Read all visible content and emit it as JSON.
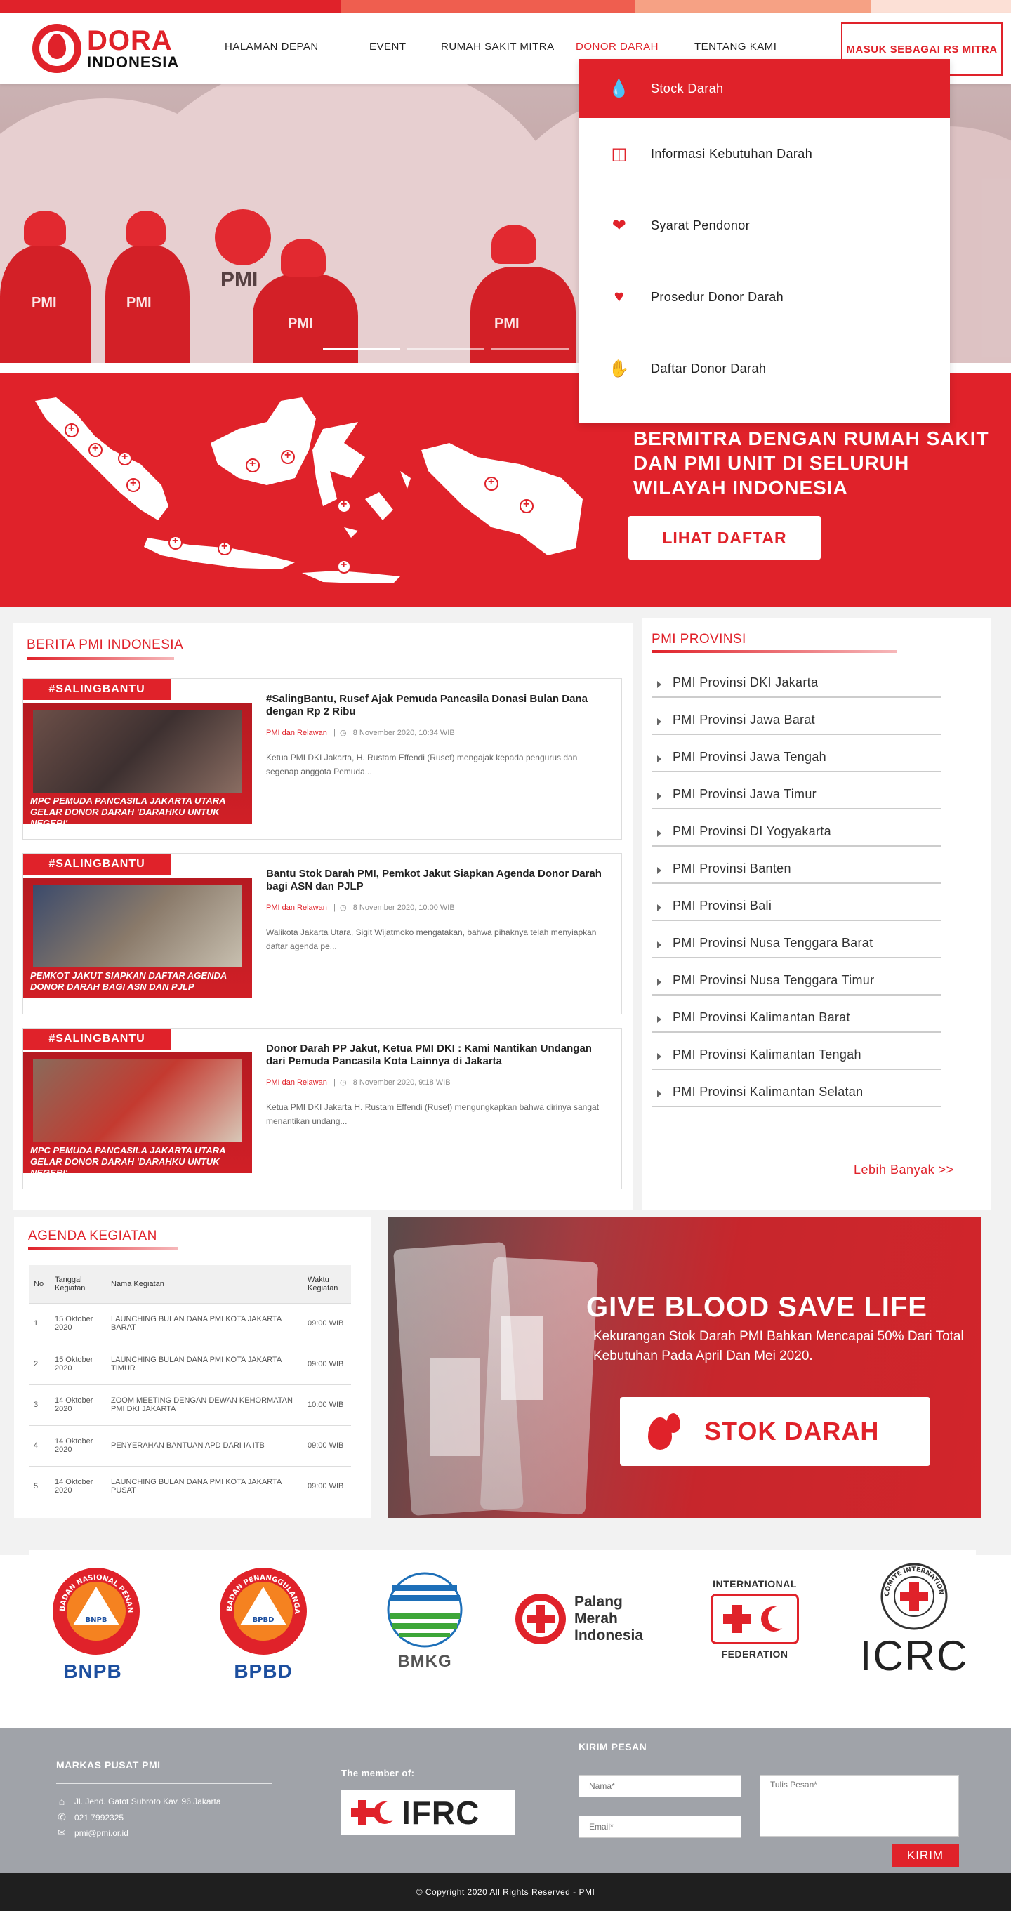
{
  "brand": {
    "name_line1": "DORA",
    "name_line2": "INDONESIA",
    "accent": "#e0222a"
  },
  "nav": {
    "items": [
      "HALAMAN DEPAN",
      "EVENT",
      "RUMAH SAKIT MITRA",
      "DONOR DARAH",
      "TENTANG KAMI"
    ],
    "active": "DONOR DARAH",
    "cta": "MASUK SEBAGAI RS MITRA"
  },
  "dropdown": {
    "items": [
      {
        "label": "Stock Darah",
        "icon": "blood-drop-icon"
      },
      {
        "label": "Informasi Kebutuhan Darah",
        "icon": "blood-bag-icon"
      },
      {
        "label": "Syarat Pendonor",
        "icon": "hand-heart-icon"
      },
      {
        "label": "Prosedur Donor Darah",
        "icon": "heart-plus-icon"
      },
      {
        "label": "Daftar Donor Darah",
        "icon": "raised-hand-icon"
      }
    ]
  },
  "hero": {
    "vest_text": "PMI"
  },
  "mitra": {
    "title": "BERMITRA DENGAN RUMAH SAKIT DAN PMI UNIT DI SELURUH WILAYAH INDONESIA",
    "button": "LIHAT DAFTAR"
  },
  "news": {
    "title": "BERITA PMI INDONESIA",
    "items": [
      {
        "tag": "#SALINGBANTU",
        "thumb_caption": "MPC PEMUDA PANCASILA JAKARTA UTARA GELAR DONOR DARAH 'DARAHKU UNTUK NEGERI'",
        "title": "#SalingBantu, Rusef Ajak Pemuda Pancasila Donasi Bulan Dana dengan Rp 2 Ribu",
        "category": "PMI dan Relawan",
        "date": "8 November 2020, 10:34 WIB",
        "excerpt": "Ketua PMI DKI Jakarta, H. Rustam Effendi (Rusef) mengajak kepada pengurus dan segenap anggota Pemuda..."
      },
      {
        "tag": "#SALINGBANTU",
        "thumb_caption": "PEMKOT JAKUT SIAPKAN DAFTAR AGENDA DONOR DARAH BAGI ASN DAN PJLP",
        "title": "Bantu Stok Darah PMI, Pemkot Jakut Siapkan Agenda Donor Darah bagi ASN dan PJLP",
        "category": "PMI dan Relawan",
        "date": "8 November 2020, 10:00 WIB",
        "excerpt": "Walikota Jakarta Utara, Sigit Wijatmoko mengatakan, bahwa pihaknya telah menyiapkan daftar agenda pe..."
      },
      {
        "tag": "#SALINGBANTU",
        "thumb_caption": "MPC PEMUDA PANCASILA JAKARTA UTARA GELAR DONOR DARAH 'DARAHKU UNTUK NEGERI'",
        "title": "Donor Darah PP Jakut, Ketua PMI DKI : Kami Nantikan Undangan dari Pemuda Pancasila Kota Lainnya di Jakarta",
        "category": "PMI dan Relawan",
        "date": "8 November 2020, 9:18 WIB",
        "excerpt": "Ketua PMI DKI Jakarta H. Rustam Effendi (Rusef) mengungkapkan bahwa dirinya sangat menantikan undang..."
      }
    ]
  },
  "provinsi": {
    "title": "PMI PROVINSI",
    "items": [
      "PMI Provinsi DKI Jakarta",
      "PMI Provinsi Jawa Barat",
      "PMI Provinsi Jawa Tengah",
      "PMI Provinsi Jawa Timur",
      "PMI Provinsi DI Yogyakarta",
      "PMI Provinsi Banten",
      "PMI Provinsi Bali",
      "PMI Provinsi Nusa Tenggara Barat",
      "PMI Provinsi Nusa Tenggara Timur",
      "PMI Provinsi Kalimantan Barat",
      "PMI Provinsi Kalimantan Tengah",
      "PMI Provinsi Kalimantan Selatan"
    ],
    "more": "Lebih Banyak >>"
  },
  "agenda": {
    "title": "AGENDA KEGIATAN",
    "headers": [
      "No",
      "Tanggal Kegiatan",
      "Nama Kegiatan",
      "Waktu Kegiatan"
    ],
    "rows": [
      [
        "1",
        "15 Oktober 2020",
        "LAUNCHING BULAN DANA PMI KOTA JAKARTA BARAT",
        "09:00 WIB"
      ],
      [
        "2",
        "15 Oktober 2020",
        "LAUNCHING BULAN DANA PMI KOTA JAKARTA TIMUR",
        "09:00 WIB"
      ],
      [
        "3",
        "14 Oktober 2020",
        "ZOOM MEETING DENGAN DEWAN KEHORMATAN PMI DKI JAKARTA",
        "10:00 WIB"
      ],
      [
        "4",
        "14 Oktober 2020",
        "PENYERAHAN BANTUAN APD DARI IA ITB",
        "09:00 WIB"
      ],
      [
        "5",
        "14 Oktober 2020",
        "LAUNCHING BULAN DANA PMI KOTA JAKARTA PUSAT",
        "09:00 WIB"
      ]
    ]
  },
  "blood": {
    "title": "GIVE BLOOD SAVE LIFE",
    "subtitle": "Kekurangan Stok Darah PMI Bahkan Mencapai 50% Dari Total Kebutuhan Pada April Dan Mei 2020.",
    "button": "STOK DARAH"
  },
  "partners": {
    "bnpb": {
      "name": "BNPB",
      "ring_text": "BADAN NASIONAL PENANGGULANGAN BENCANA",
      "inner": "BNPB"
    },
    "bpbd": {
      "name": "BPBD",
      "ring_text": "BADAN PENANGGULANGAN BENCANA DAERAH",
      "inner": "BPBD"
    },
    "bmkg": {
      "name": "BMKG"
    },
    "pmi": {
      "name": "Palang Merah Indonesia"
    },
    "ifed": {
      "top": "INTERNATIONAL",
      "bottom": "FEDERATION"
    },
    "icrc": {
      "name": "ICRC",
      "ring_text": "COMITE INTERNATIONAL GENEVE"
    }
  },
  "footer": {
    "hq_title": "MARKAS PUSAT PMI",
    "address": "Jl. Jend. Gatot Subroto Kav. 96 Jakarta",
    "phone": "021 7992325",
    "email": "pmi@pmi.or.id",
    "member_title": "The member of:",
    "member_name": "IFRC",
    "contact_title": "KIRIM PESAN",
    "name_placeholder": "Nama*",
    "email_placeholder": "Email*",
    "message_placeholder": "Tulis Pesan*",
    "send": "KIRIM",
    "copyright": "© Copyright 2020 All Rights Reserved - PMI"
  }
}
